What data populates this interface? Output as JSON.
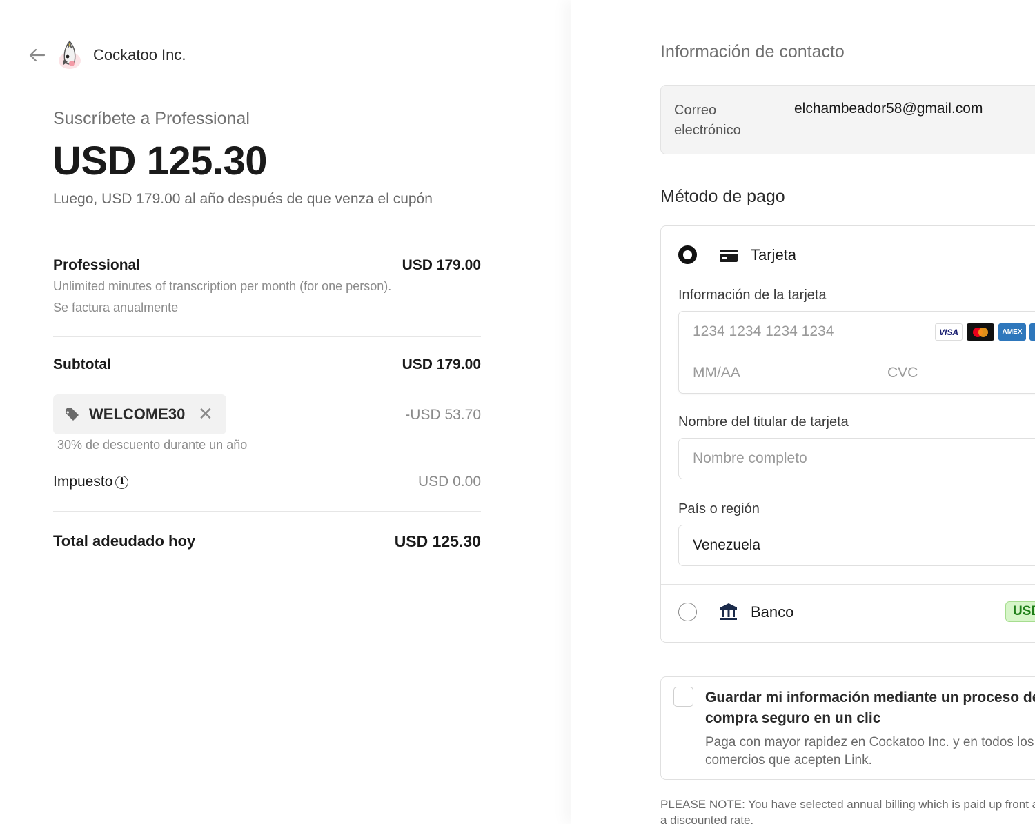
{
  "merchant": {
    "name": "Cockatoo Inc."
  },
  "summary": {
    "subscribe_title": "Suscríbete a Professional",
    "big_price": "USD 125.30",
    "after_note": "Luego, USD 179.00 al año después de que venza el cupón"
  },
  "line_item": {
    "name": "Professional",
    "price": "USD 179.00",
    "description": "Unlimited minutes of transcription per month (for one person).",
    "billing": "Se factura anualmente"
  },
  "subtotal": {
    "label": "Subtotal",
    "value": "USD 179.00"
  },
  "coupon": {
    "code": "WELCOME30",
    "discount": "-USD 53.70",
    "description": "30% de descuento durante un año"
  },
  "tax": {
    "label": "Impuesto",
    "value": "USD 0.00"
  },
  "total": {
    "label": "Total adeudado hoy",
    "value": "USD 125.30"
  },
  "contact": {
    "heading": "Información de contacto",
    "email_label": "Correo electrónico",
    "email_value": "elchambeador58@gmail.com"
  },
  "payment": {
    "heading": "Método de pago",
    "card_option": "Tarjeta",
    "card_info_label": "Información de la tarjeta",
    "card_number_placeholder": "1234 1234 1234 1234",
    "expiry_placeholder": "MM/AA",
    "cvc_placeholder": "CVC",
    "card_brands": [
      "VISA",
      "Mastercard",
      "American Express",
      "Discover"
    ],
    "holder_label": "Nombre del titular de tarjeta",
    "holder_placeholder": "Nombre completo",
    "country_label": "País o región",
    "country_value": "Venezuela",
    "bank_option": "Banco",
    "bank_badge": "USD"
  },
  "save_info": {
    "title": "Guardar mi información mediante un proceso de compra seguro en un clic",
    "description": "Paga con mayor rapidez en Cockatoo Inc. y en todos los comercios que acepten Link."
  },
  "note": "PLEASE NOTE: You have selected annual billing which is paid up front at a discounted rate.",
  "colors": {
    "usd_badge_bg": "#d6f5c8",
    "usd_badge_text": "#1e7e18",
    "radio_selected": "#111111"
  }
}
